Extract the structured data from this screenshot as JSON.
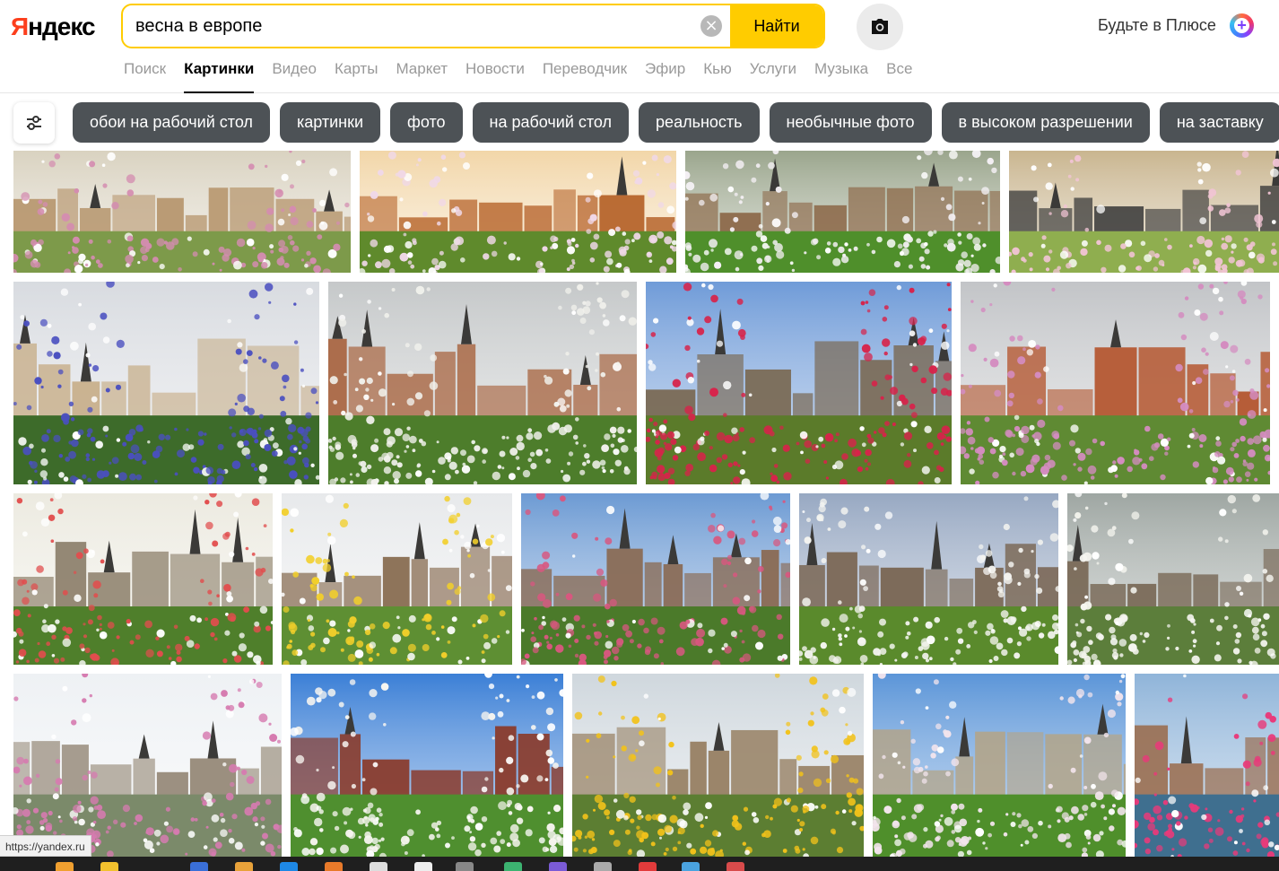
{
  "brand": {
    "logo_text": "Яндекс"
  },
  "search": {
    "query": "весна в европе",
    "find_label": "Найти"
  },
  "plus": {
    "label": "Будьте в Плюсе",
    "icon_glyph": "+"
  },
  "nav": {
    "items": [
      {
        "label": "Поиск",
        "active": false
      },
      {
        "label": "Картинки",
        "active": true
      },
      {
        "label": "Видео",
        "active": false
      },
      {
        "label": "Карты",
        "active": false
      },
      {
        "label": "Маркет",
        "active": false
      },
      {
        "label": "Новости",
        "active": false
      },
      {
        "label": "Переводчик",
        "active": false
      },
      {
        "label": "Эфир",
        "active": false
      },
      {
        "label": "Кью",
        "active": false
      },
      {
        "label": "Услуги",
        "active": false
      },
      {
        "label": "Музыка",
        "active": false
      },
      {
        "label": "Все",
        "active": false
      }
    ]
  },
  "chips": [
    "обои на рабочий стол",
    "картинки",
    "фото",
    "на рабочий стол",
    "реальность",
    "необычные фото",
    "в высоком разрешении",
    "на заставку"
  ],
  "status_url": "https://yandex.ru",
  "colors": {
    "accent": "#ffcc00",
    "chip_bg": "#4d5256",
    "logo_red": "#fc3f1d"
  },
  "images": [
    {
      "theme": "baroque facade with magnolia",
      "palette": [
        "#d9d2c0",
        "#b99a73",
        "#7d9a4a",
        "#d48cb0"
      ]
    },
    {
      "theme": "castle with magnolia",
      "palette": [
        "#f2d6a8",
        "#b8672f",
        "#5f8a2c",
        "#f0d8e8"
      ]
    },
    {
      "theme": "tulip garden",
      "palette": [
        "#9aa58c",
        "#8e6b4c",
        "#4f8f2b",
        "#f4f0f4"
      ]
    },
    {
      "theme": "bicycles and blossoms",
      "palette": [
        "#c9b58f",
        "#3b3b3b",
        "#8fae4f",
        "#f1c4d4"
      ]
    },
    {
      "theme": "blue irises in pot",
      "palette": [
        "#d8dbe0",
        "#c8b08c",
        "#3d6b2a",
        "#4a4fc0"
      ]
    },
    {
      "theme": "prague castle",
      "palette": [
        "#c5c8c9",
        "#a6603a",
        "#4d7d2b",
        "#f1f1ec"
      ]
    },
    {
      "theme": "tyn church with red blossom",
      "palette": [
        "#6f9bd8",
        "#7a6a55",
        "#5b7b2a",
        "#d7234a"
      ]
    },
    {
      "theme": "red roofs and lilac",
      "palette": [
        "#c2c4c7",
        "#b55a34",
        "#5f8a33",
        "#d48cc0"
      ]
    },
    {
      "theme": "eiffel tower flower bed",
      "palette": [
        "#eceae0",
        "#8c7f6a",
        "#4f7f2b",
        "#e14d4d"
      ]
    },
    {
      "theme": "eiffel tower pansies",
      "palette": [
        "#e7e9eb",
        "#8a6f55",
        "#5e8f33",
        "#f2cf2a"
      ]
    },
    {
      "theme": "eiffel tower magnolia sky",
      "palette": [
        "#6c9ad3",
        "#8a6b55",
        "#4b7a2a",
        "#d8577f"
      ]
    },
    {
      "theme": "prague castle white trees",
      "palette": [
        "#97a8c2",
        "#7d6b5a",
        "#5a8a2c",
        "#f4f4f0"
      ]
    },
    {
      "theme": "blurred cathedral apple blossom",
      "palette": [
        "#9ea6a2",
        "#7a6a58",
        "#5c7e3b",
        "#f5f5ef"
      ]
    },
    {
      "theme": "paris skyline pink blossom",
      "palette": [
        "#eef1f4",
        "#9b8f7f",
        "#7b8a6a",
        "#d67bb0"
      ]
    },
    {
      "theme": "spire through apple blossom",
      "palette": [
        "#3b7fd6",
        "#8a3a2a",
        "#4f8f2f",
        "#f7f5f0"
      ]
    },
    {
      "theme": "square with yellow tulips",
      "palette": [
        "#cfd7dd",
        "#9a8468",
        "#5c7e32",
        "#f2c21a"
      ]
    },
    {
      "theme": "magnolia tree garden",
      "palette": [
        "#5b95d8",
        "#b3a488",
        "#4f8f2b",
        "#f2e4ec"
      ]
    },
    {
      "theme": "canal with flower boxes",
      "palette": [
        "#8fb4d9",
        "#9a6d4f",
        "#3f6f8f",
        "#e83a7a"
      ]
    }
  ]
}
